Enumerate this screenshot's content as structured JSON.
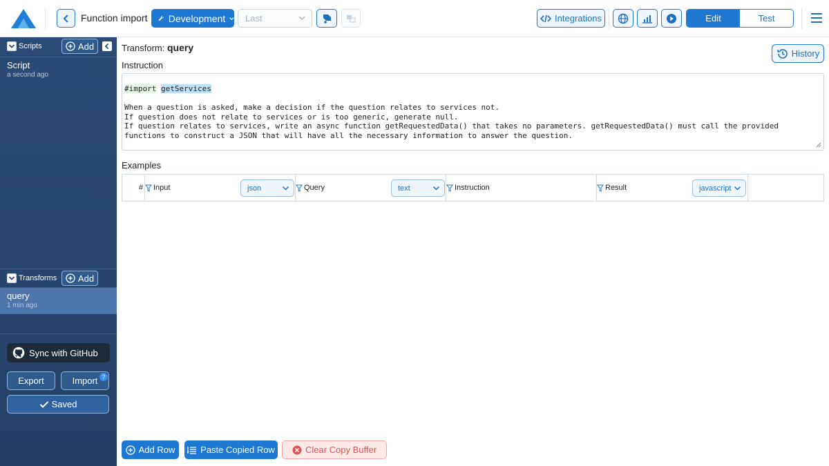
{
  "header": {
    "title": "Function import",
    "environment": "Development",
    "version_select": {
      "value": "Last",
      "placeholder": "Last"
    },
    "integrations_label": "Integrations",
    "mode": {
      "edit": "Edit",
      "test": "Test",
      "active": "Edit"
    }
  },
  "sidebar": {
    "scripts": {
      "label": "Scripts",
      "add_label": "Add",
      "items": [
        {
          "name": "Script",
          "time": "a second ago"
        }
      ]
    },
    "transforms": {
      "label": "Transforms",
      "add_label": "Add",
      "items": [
        {
          "name": "query",
          "time": "1 min ago",
          "active": true
        }
      ]
    },
    "github_label": "Sync with GitHub",
    "export_label": "Export",
    "import_label": "Import",
    "import_badge": "?",
    "saved_label": "Saved"
  },
  "main": {
    "transform_prefix": "Transform:",
    "transform_name": "query",
    "history_label": "History",
    "instruction_label": "Instruction",
    "instruction": {
      "import_keyword": "#import",
      "import_name": "getServices",
      "lines": [
        "When a question is asked, make a decision if the question relates to services not.",
        "If question does not relate to services or is too generic, generate null.",
        "If question relates to services, write an async function getRequestedData() that takes no parameters. getRequestedData() must call the provided",
        "functions to construct a JSON that will have all the necessary information to answer the question."
      ]
    },
    "examples_label": "Examples",
    "grid": {
      "index_header": "#",
      "columns": [
        {
          "name": "Input",
          "type": "json"
        },
        {
          "name": "Query",
          "type": "text"
        },
        {
          "name": "Instruction",
          "type": ""
        },
        {
          "name": "Result",
          "type": "javascript"
        }
      ]
    },
    "actions": {
      "add_row": "Add Row",
      "paste_row": "Paste Copied Row",
      "clear_buffer": "Clear Copy Buffer"
    }
  },
  "colors": {
    "primary": "#1f78d1",
    "sidebar": "#2b4a75",
    "active_item": "#4d76ad",
    "danger": "#e05353"
  },
  "icons": [
    "logo-icon",
    "chevron-left-icon",
    "wrench-icon",
    "chevron-down-icon",
    "deploy-icon",
    "translate-icon",
    "code-icon",
    "globe-icon",
    "bar-chart-icon",
    "play-icon",
    "hamburger-icon",
    "plus-circle-icon",
    "collapse-icon",
    "github-icon",
    "check-icon",
    "history-icon",
    "filter-icon",
    "paste-icon",
    "close-circle-icon"
  ]
}
